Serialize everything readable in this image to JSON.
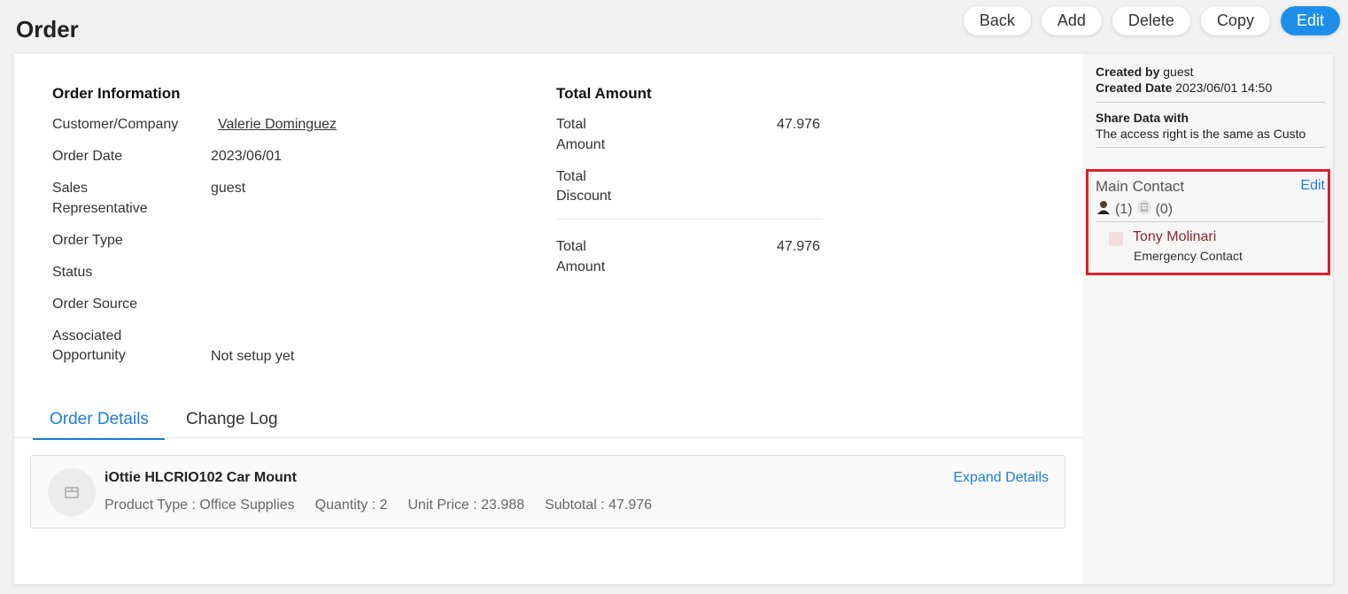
{
  "page": {
    "title": "Order"
  },
  "toolbar": {
    "back": "Back",
    "add": "Add",
    "delete": "Delete",
    "copy": "Copy",
    "edit": "Edit"
  },
  "order_info": {
    "title": "Order Information",
    "customer_label": "Customer/Company",
    "customer_value": "Valerie Dominguez",
    "date_label": "Order Date",
    "date_value": "2023/06/01",
    "sales_label_1": "Sales",
    "sales_label_2": "Representative",
    "sales_value": "guest",
    "type_label": "Order Type",
    "status_label": "Status",
    "source_label": "Order Source",
    "opp_label_1": "Associated",
    "opp_label_2": "Opportunity",
    "opp_value": "Not setup yet"
  },
  "total": {
    "title": "Total Amount",
    "amount_label_1": "Total",
    "amount_label_2": "Amount",
    "amount_value": "47.976",
    "discount_label_1": "Total",
    "discount_label_2": "Discount",
    "final_label_1": "Total",
    "final_label_2": "Amount",
    "final_value": "47.976"
  },
  "tabs": {
    "details": "Order Details",
    "changelog": "Change Log"
  },
  "product": {
    "name": "iOttie HLCRIO102 Car Mount",
    "type": "Product Type : Office Supplies",
    "quantity": "Quantity : 2",
    "unit_price": "Unit Price : 23.988",
    "subtotal": "Subtotal : 47.976",
    "expand": "Expand Details"
  },
  "sidebar": {
    "created_by_label": "Created by",
    "created_by_value": "guest",
    "created_date_label": "Created Date",
    "created_date_value": "2023/06/01 14:50",
    "share_title": "Share Data with",
    "share_text": "The access right is the same as Custo",
    "main_contact": "Main Contact",
    "edit": "Edit",
    "person_count": "(1)",
    "company_count": "(0)",
    "contact_name": "Tony Molinari",
    "contact_role": "Emergency Contact"
  },
  "colors": {
    "accent": "#1e8fe8",
    "highlight_border": "#e01e2a",
    "contact_name": "#8b2a2a"
  }
}
